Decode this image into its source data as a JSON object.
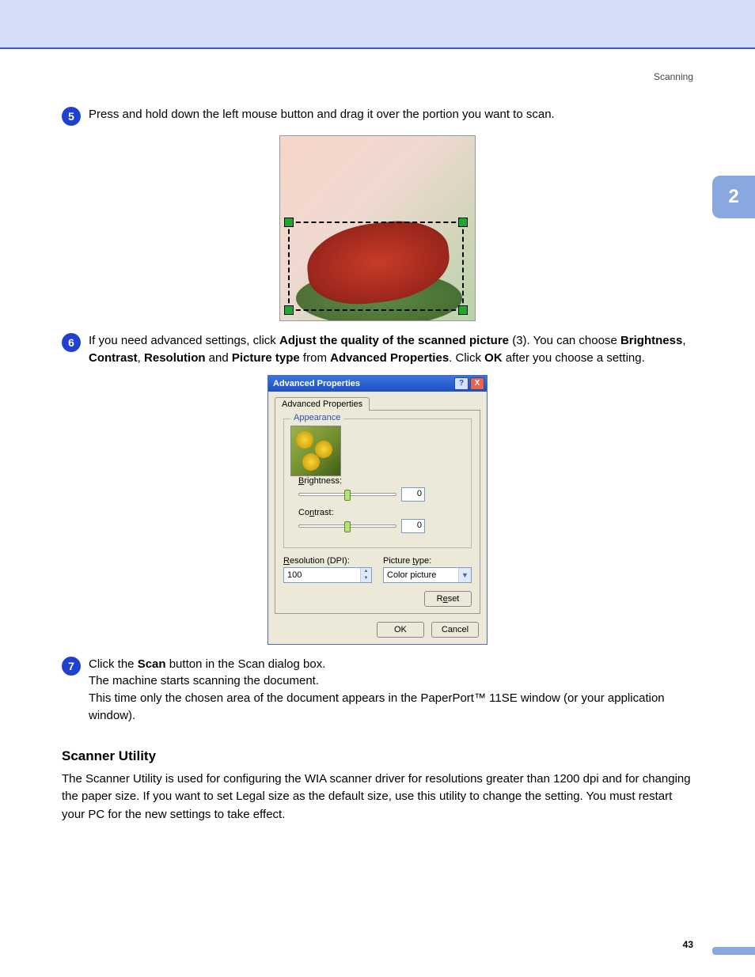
{
  "header": {
    "section": "Scanning"
  },
  "chapter_tab": "2",
  "steps": {
    "s5": {
      "num": "5",
      "text": "Press and hold down the left mouse button and drag it over the portion you want to scan."
    },
    "s6": {
      "num": "6",
      "t1": "If you need advanced settings, click ",
      "bold1": "Adjust the quality of the scanned picture",
      "t2": " (3). You can choose ",
      "bold2": "Brightness",
      "t3": ", ",
      "bold3": "Contrast",
      "t4": ", ",
      "bold4": "Resolution",
      "t5": " and ",
      "bold5": "Picture type",
      "t6": " from ",
      "bold6": "Advanced Properties",
      "t7": ". Click ",
      "bold7": "OK",
      "t8": " after you choose a setting."
    },
    "s7": {
      "num": "7",
      "t1": "Click the ",
      "bold1": "Scan",
      "t2": " button in the Scan dialog box.",
      "line2": "The machine starts scanning the document.",
      "line3": "This time only the chosen area of the document appears in the PaperPort™ 11SE window (or your application window)."
    }
  },
  "dialog": {
    "title": "Advanced Properties",
    "tab": "Advanced Properties",
    "group": "Appearance",
    "brightness_label_pre": "B",
    "brightness_label_rest": "rightness:",
    "brightness_value": "0",
    "contrast_label_pre": "Co",
    "contrast_label_ul": "n",
    "contrast_label_post": "trast:",
    "contrast_value": "0",
    "resolution_label_pre": "R",
    "resolution_label_rest": "esolution (DPI):",
    "resolution_value": "100",
    "picture_type_label_pre": "Picture ",
    "picture_type_label_ul": "t",
    "picture_type_label_post": "ype:",
    "picture_type_value": "Color picture",
    "reset_pre": "R",
    "reset_ul": "e",
    "reset_post": "set",
    "ok": "OK",
    "cancel": "Cancel",
    "help_btn": "?",
    "close_btn": "X"
  },
  "scanner_utility": {
    "heading": "Scanner Utility",
    "body": "The Scanner Utility is used for configuring the WIA scanner driver for resolutions greater than 1200 dpi and for changing the paper size. If you want to set Legal size as the default size, use this utility to change the setting. You must restart your PC for the new settings to take effect."
  },
  "page_number": "43"
}
